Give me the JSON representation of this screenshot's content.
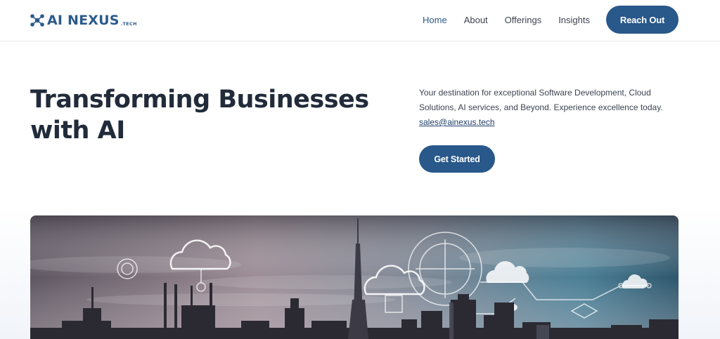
{
  "brand": {
    "name": "AI NEXUS",
    "suffix": ".TECH",
    "icon": "network-nodes-icon",
    "color": "#2c5a8c"
  },
  "nav": {
    "items": [
      {
        "label": "Home",
        "active": true
      },
      {
        "label": "About",
        "active": false
      },
      {
        "label": "Offerings",
        "active": false
      },
      {
        "label": "Insights",
        "active": false
      }
    ],
    "cta_label": "Reach Out"
  },
  "hero": {
    "title": "Transforming Businesses with AI",
    "description": "Your destination for exceptional Software Development, Cloud Solutions, AI services, and Beyond. Experience excellence today.",
    "email": "sales@ainexus.tech",
    "cta_label": "Get Started",
    "image": {
      "subject": "city-skyline-with-cloud-and-network-overlays",
      "icons": [
        "cloud-icon",
        "gear-icon",
        "target-icon",
        "network-icon"
      ]
    }
  },
  "colors": {
    "accent": "#29588a",
    "heading": "#212b3a",
    "text": "#3d4350",
    "link": "#1f3f68"
  }
}
